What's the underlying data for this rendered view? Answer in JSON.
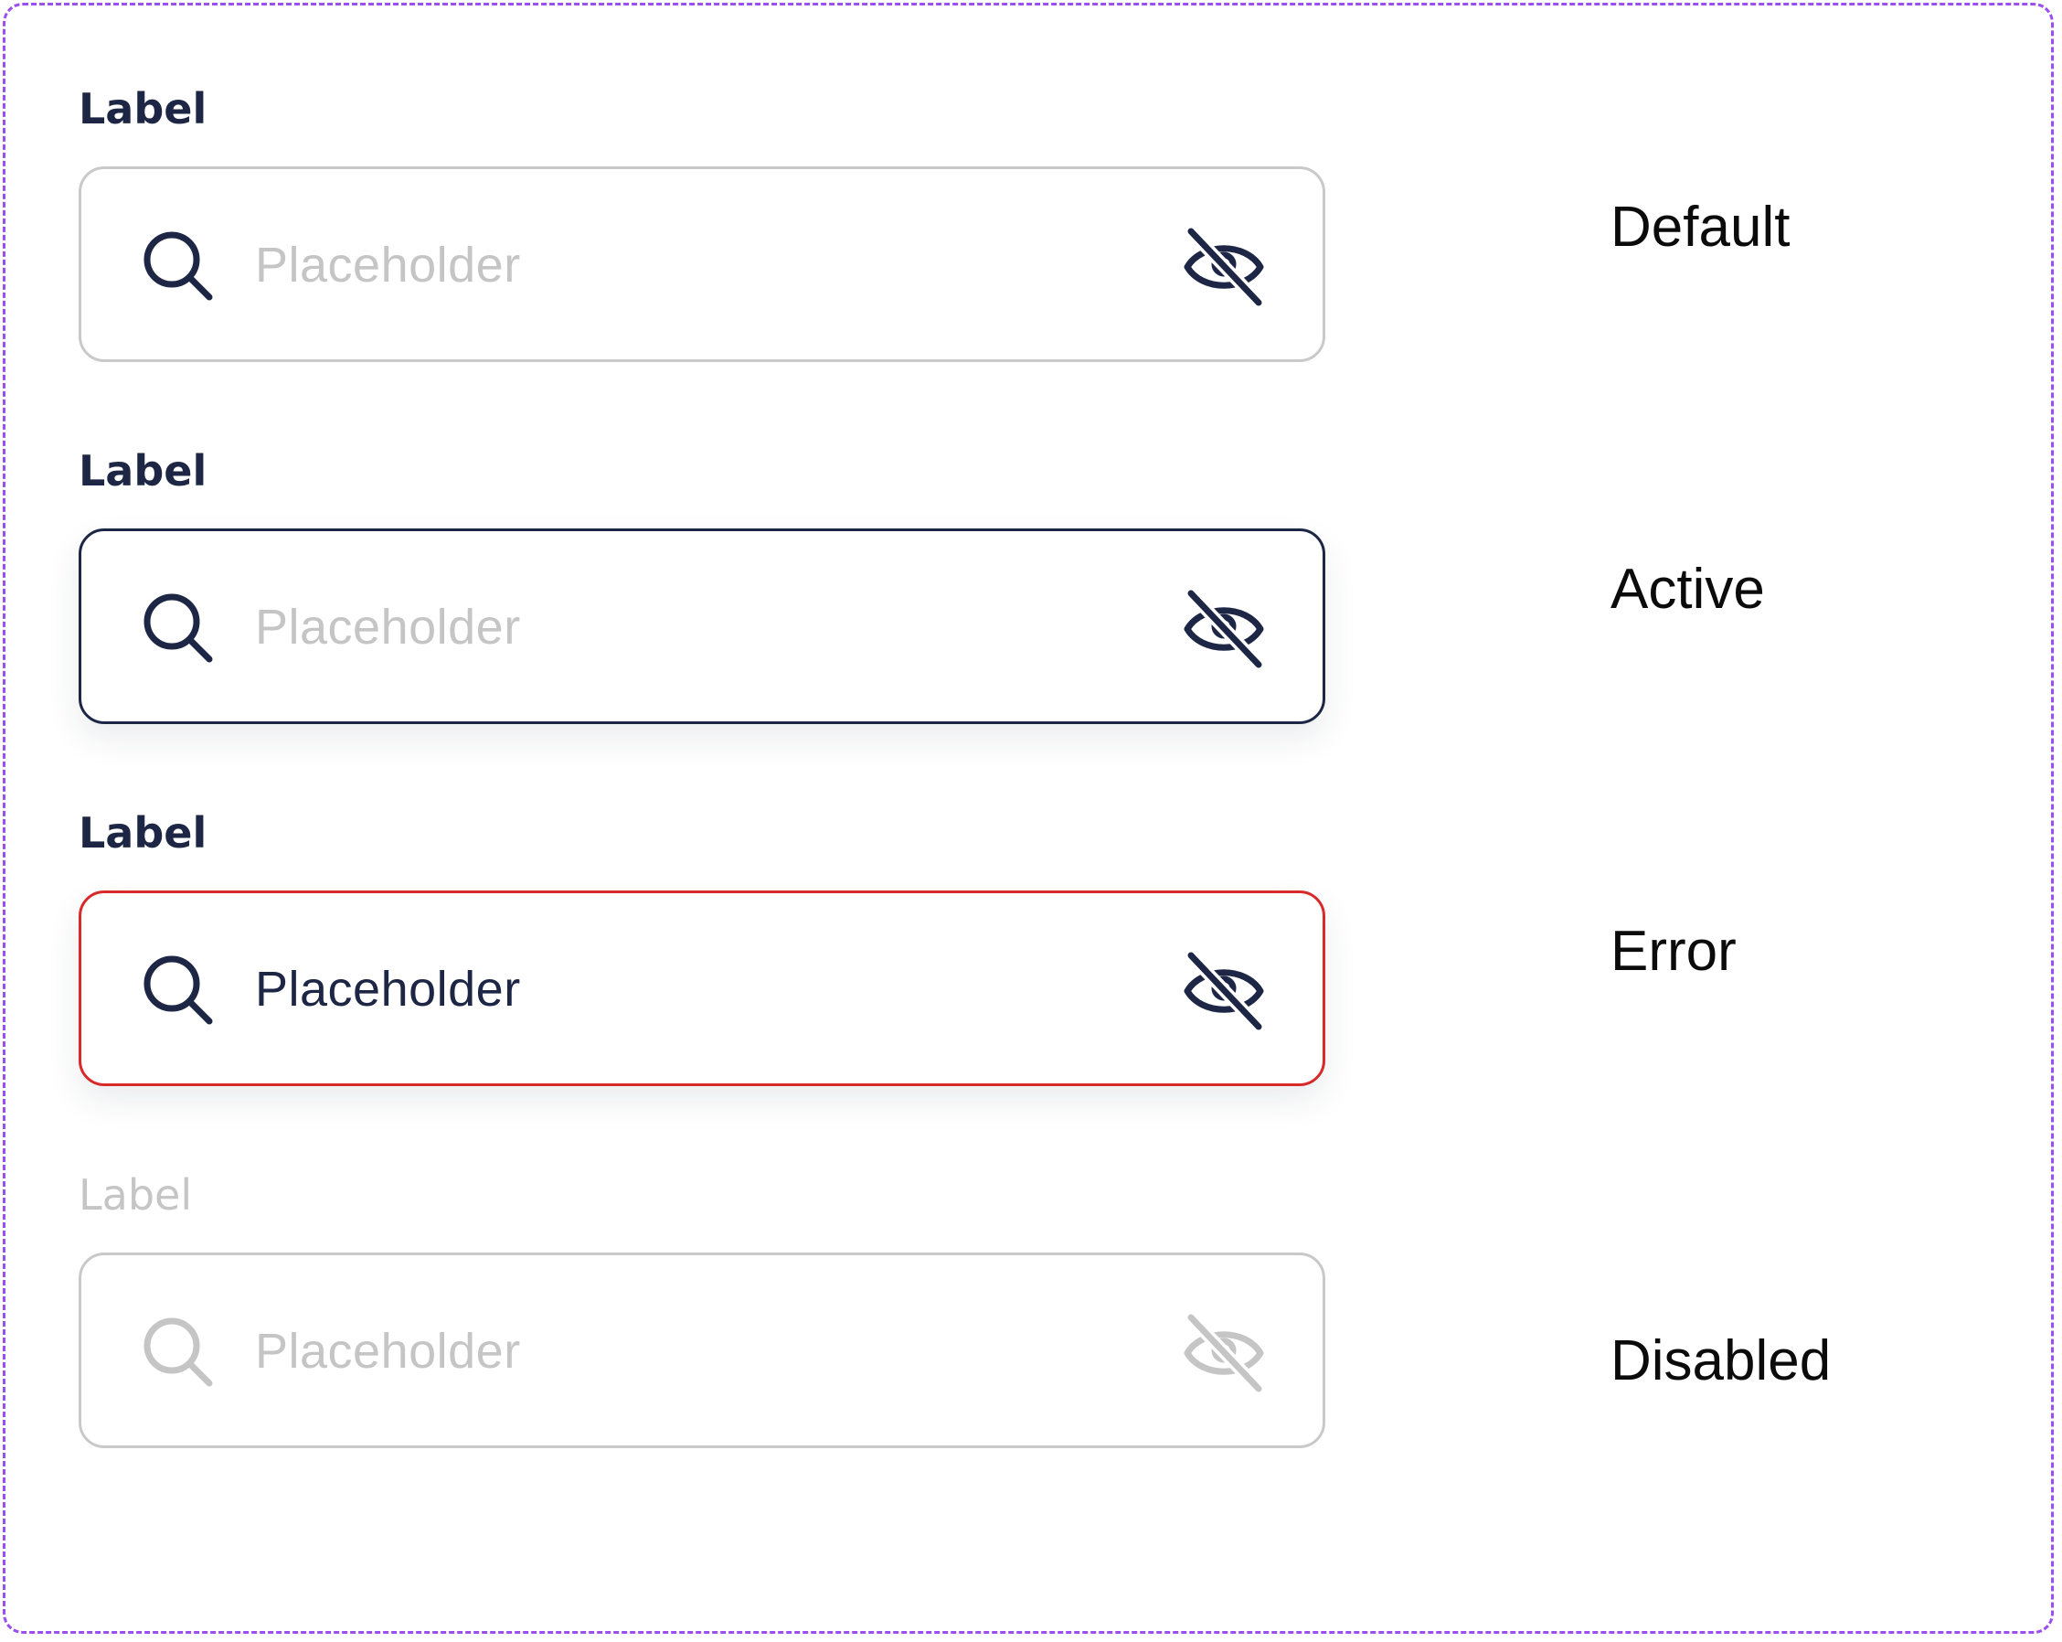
{
  "colors": {
    "frame_border": "#9b4ff0",
    "text_dark": "#1d2745",
    "placeholder": "#c5c5c5",
    "border_default": "#c9c9c9",
    "border_active": "#1d2745",
    "border_error": "#d82a2a",
    "disabled": "#c5c5c5"
  },
  "fields": [
    {
      "state": "default",
      "label": "Label",
      "placeholder": "Placeholder",
      "state_label": "Default",
      "search_icon": "search-icon",
      "toggle_icon": "eye-off-icon"
    },
    {
      "state": "active",
      "label": "Label",
      "placeholder": "Placeholder",
      "state_label": "Active",
      "search_icon": "search-icon",
      "toggle_icon": "eye-off-icon"
    },
    {
      "state": "error",
      "label": "Label",
      "placeholder": "Placeholder",
      "state_label": "Error",
      "search_icon": "search-icon",
      "toggle_icon": "eye-off-icon"
    },
    {
      "state": "disabled",
      "label": "Label",
      "placeholder": "Placeholder",
      "state_label": "Disabled",
      "search_icon": "search-icon",
      "toggle_icon": "eye-off-icon"
    }
  ]
}
